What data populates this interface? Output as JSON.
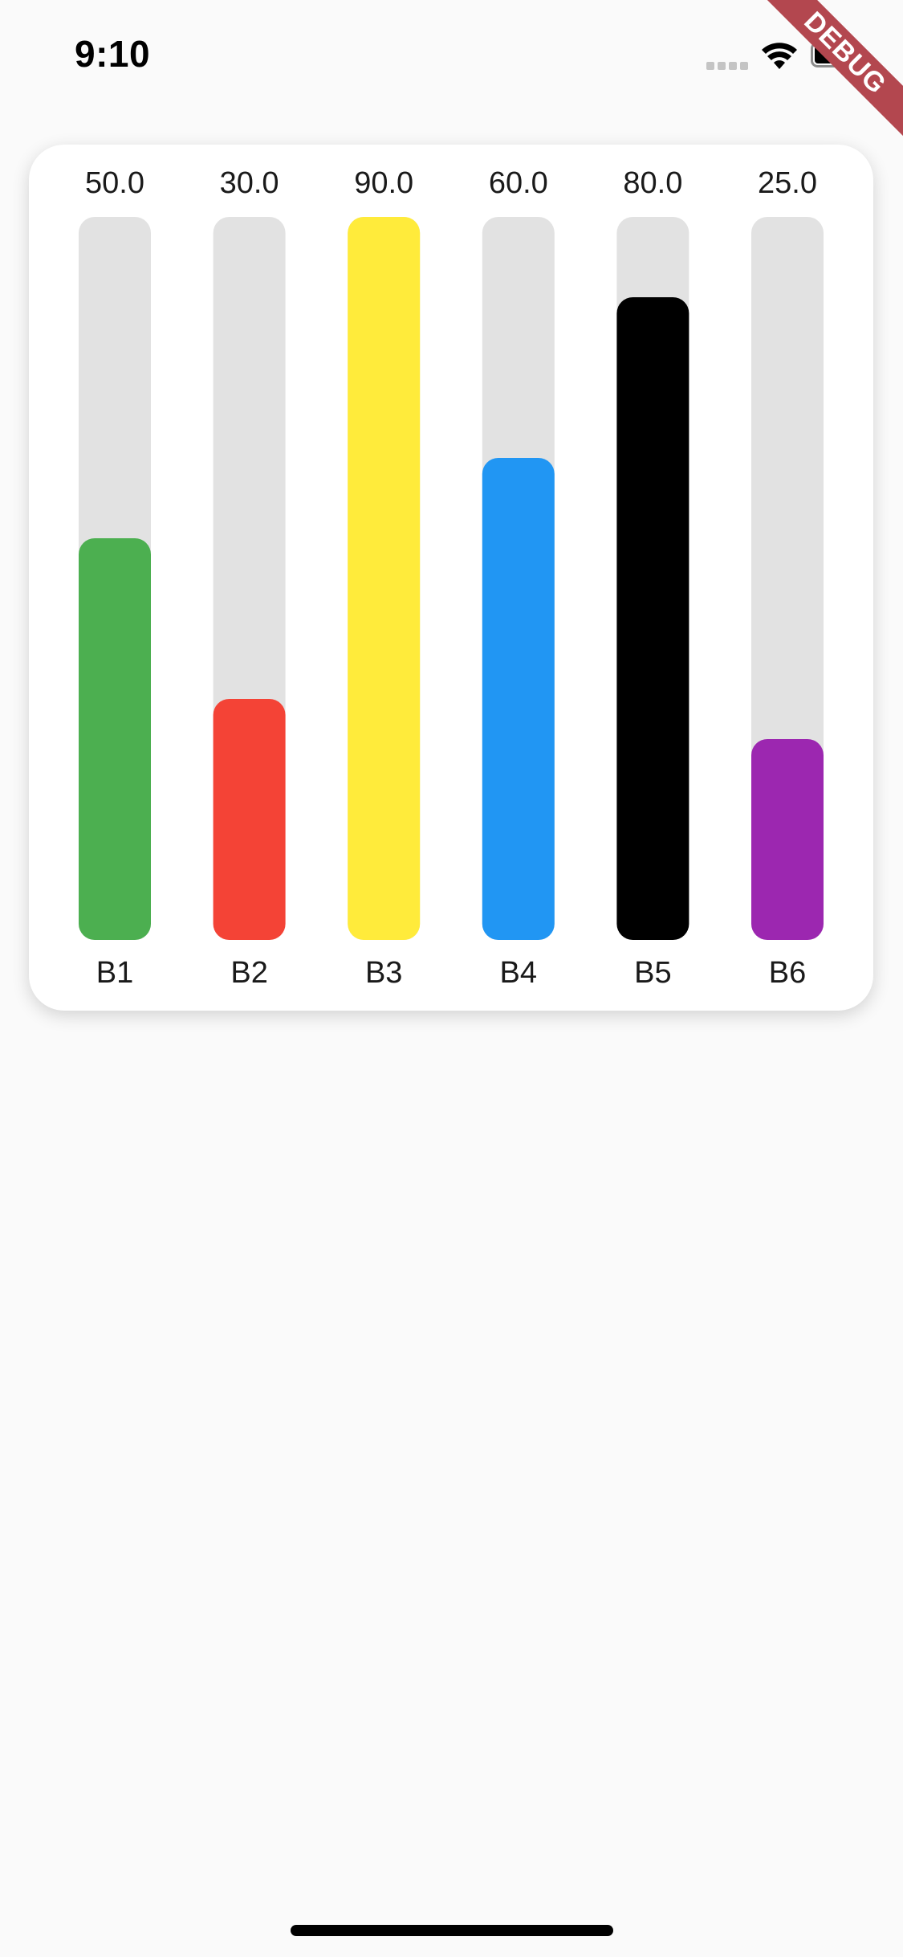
{
  "status_bar": {
    "time": "9:10",
    "icons": [
      "signal-icon",
      "wifi-icon",
      "battery-icon"
    ]
  },
  "debug_banner": {
    "label": "DEBUG",
    "color": "#b3474f"
  },
  "chart_data": {
    "type": "bar",
    "categories": [
      "B1",
      "B2",
      "B3",
      "B4",
      "B5",
      "B6"
    ],
    "values": [
      50.0,
      30.0,
      90.0,
      60.0,
      80.0,
      25.0
    ],
    "value_labels": [
      "50.0",
      "30.0",
      "90.0",
      "60.0",
      "80.0",
      "25.0"
    ],
    "colors": [
      "#4caf50",
      "#f44336",
      "#ffeb3b",
      "#2196f3",
      "#000000",
      "#9c27b0"
    ],
    "track_color": "#e2e2e2",
    "ylim": [
      0,
      90
    ],
    "grid": false,
    "legend": "none"
  }
}
